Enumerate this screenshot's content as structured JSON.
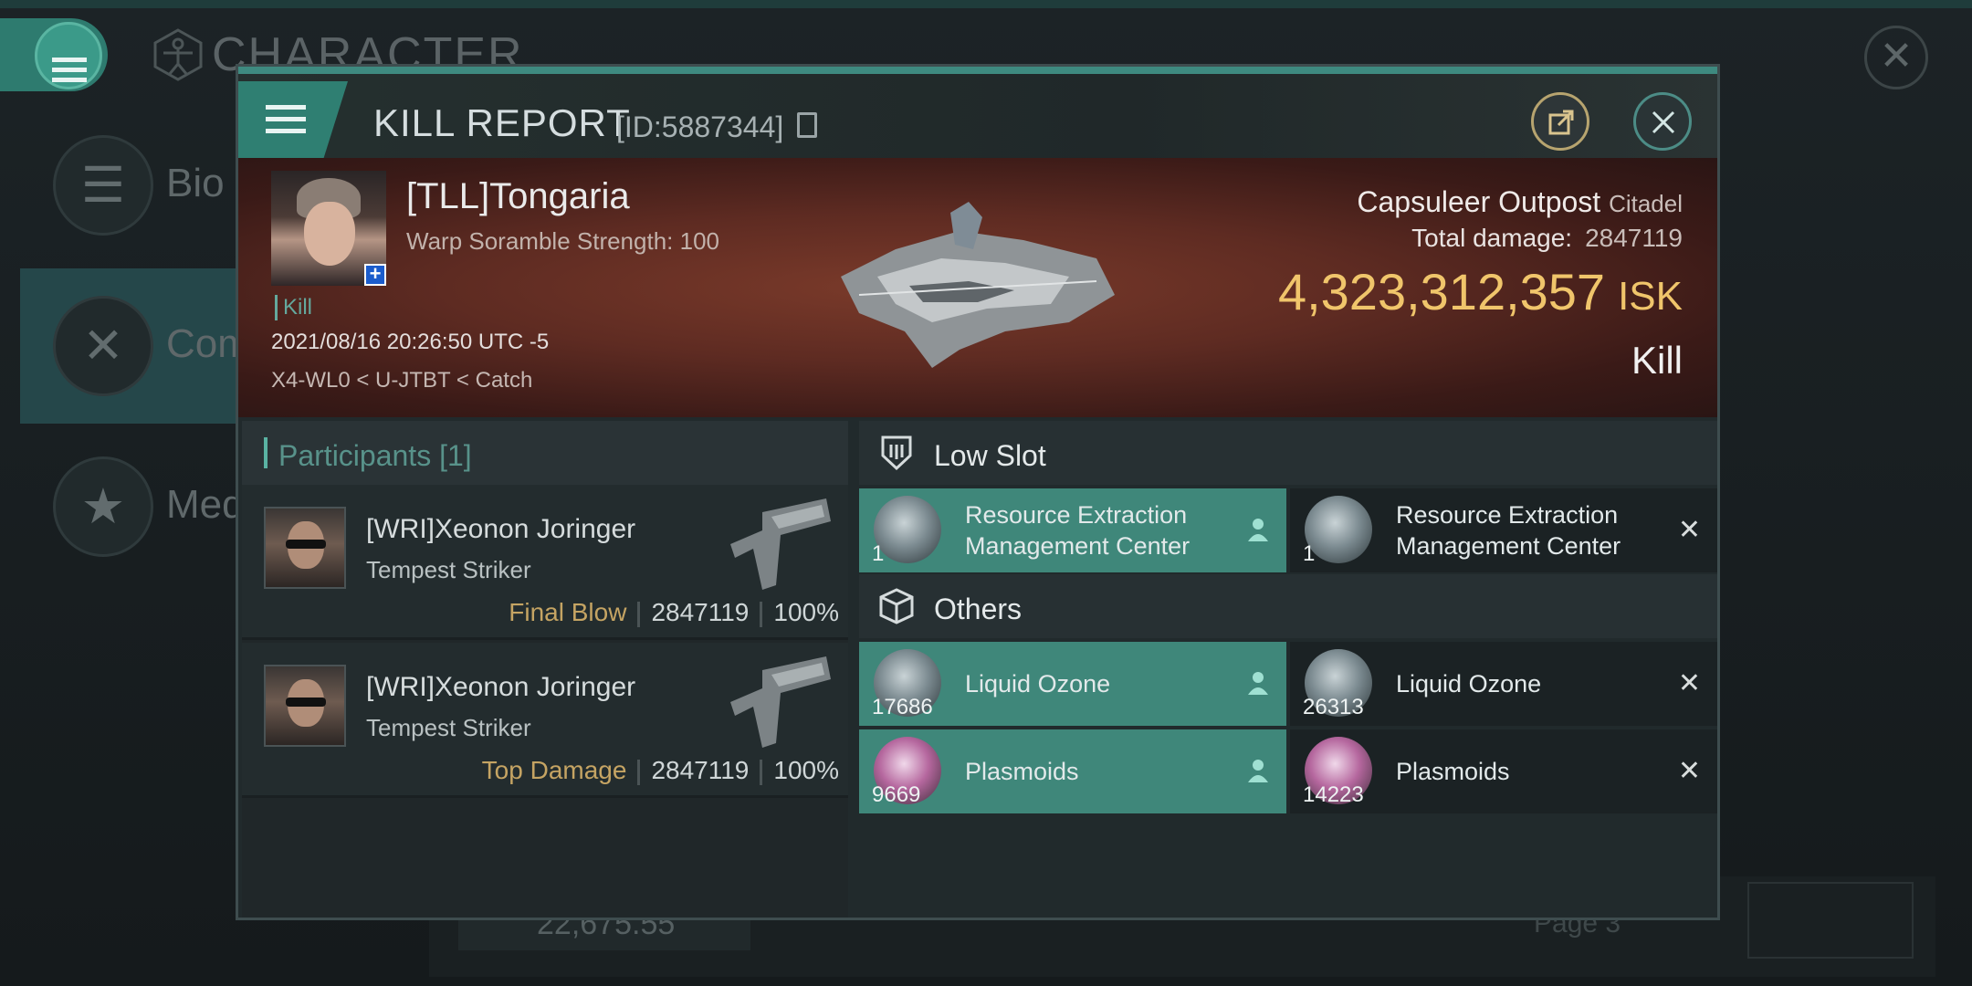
{
  "background": {
    "title": "CHARACTER",
    "sidebar": [
      {
        "label": "Bio",
        "icon": "list-icon"
      },
      {
        "label": "Com",
        "icon": "crossed-swords-icon"
      },
      {
        "label": "Med",
        "icon": "star-badge-icon"
      }
    ],
    "bottom_value": "22,675.55",
    "page_label": "Page 3"
  },
  "modal": {
    "title": "KILL REPORT",
    "id_label": "[ID:5887344]"
  },
  "banner": {
    "pilot_name": "[TLL]Tongaria",
    "warp_strength": "Warp Soramble Strength: 100",
    "kill_tag": "Kill",
    "datetime": "2021/08/16 20:26:50 UTC -5",
    "location": "X4-WL0 < U-JTBT < Catch",
    "target_name": "Capsuleer Outpost",
    "target_type": "Citadel",
    "total_damage_label": "Total damage:",
    "total_damage_value": "2847119",
    "isk_value": "4,323,312,357",
    "isk_unit": "ISK",
    "result": "Kill"
  },
  "participants": {
    "header": "Participants [1]",
    "rows": [
      {
        "name": "[WRI]Xeonon Joringer",
        "ship": "Tempest Striker",
        "label": "Final Blow",
        "damage": "2847119",
        "percent": "100%"
      },
      {
        "name": "[WRI]Xeonon Joringer",
        "ship": "Tempest Striker",
        "label": "Top Damage",
        "damage": "2847119",
        "percent": "100%"
      }
    ]
  },
  "items": {
    "low_slot_title": "Low Slot",
    "others_title": "Others",
    "low_slot": [
      {
        "name_line1": "Resource Extraction",
        "name_line2": "Management Center",
        "qty": "1",
        "status": "owned"
      },
      {
        "name_line1": "Resource Extraction",
        "name_line2": "Management Center",
        "qty": "1",
        "status": "destroyed"
      }
    ],
    "others": [
      {
        "name": "Liquid Ozone",
        "qty": "17686",
        "status": "owned"
      },
      {
        "name": "Liquid Ozone",
        "qty": "26313",
        "status": "destroyed"
      },
      {
        "name": "Plasmoids",
        "qty": "9669",
        "status": "owned"
      },
      {
        "name": "Plasmoids",
        "qty": "14223",
        "status": "destroyed"
      }
    ]
  },
  "colors": {
    "accent_teal": "#3f877a",
    "isk_gold": "#f0c56b",
    "label_gold": "#c5a463"
  }
}
